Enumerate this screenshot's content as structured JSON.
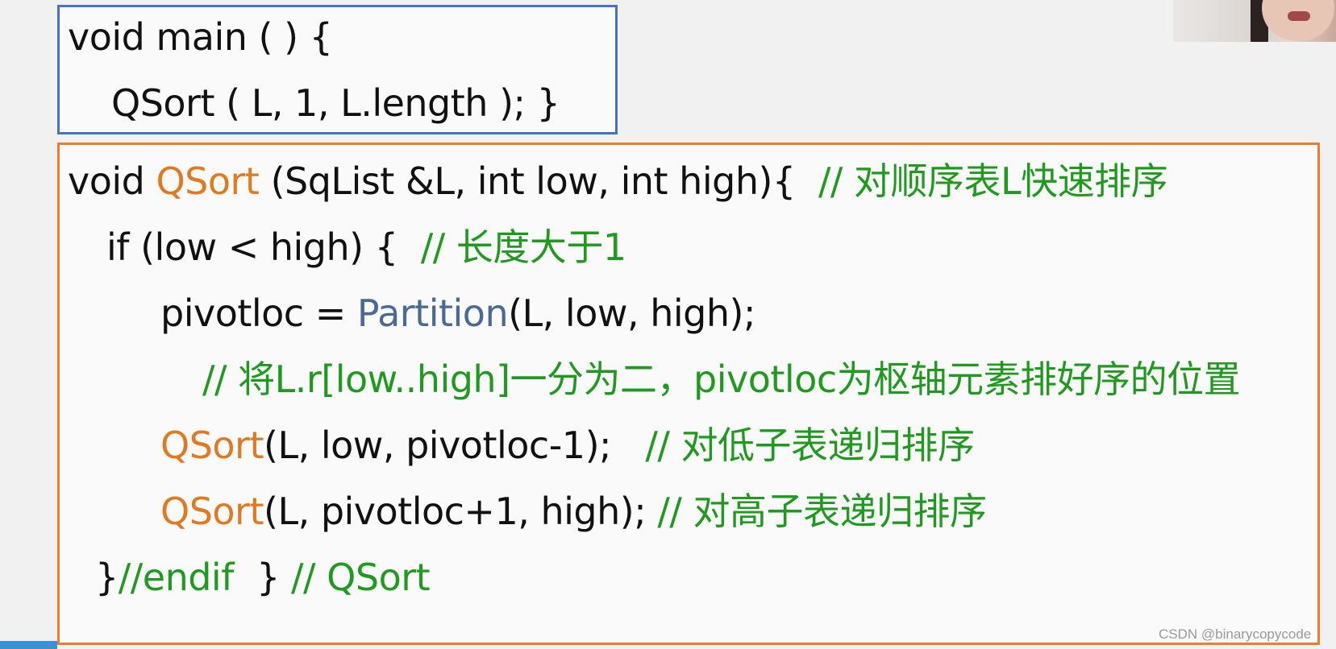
{
  "main_block": {
    "line1": "void main ( ) {",
    "line2": "QSort ( L, 1, L.length ); }"
  },
  "qsort_block": {
    "l1_kw": "void ",
    "l1_fn": "QSort",
    "l1_rest": " (SqList &L, int low, int high){  ",
    "l1_cm": "// 对顺序表L快速排序",
    "l2_code": "if (low < high) {  ",
    "l2_cm": "// 长度大于1",
    "l3_a": "pivotloc = ",
    "l3_call": "Partition",
    "l3_b": "(L, low, high);",
    "l4_cm": "// 将L.r[low..high]一分为二，pivotloc为枢轴元素排好序的位置",
    "l5_fn": "QSort",
    "l5_rest": "(L, low, pivotloc-1);   ",
    "l5_cm": "// 对低子表递归排序",
    "l6_fn": "QSort",
    "l6_rest": "(L, pivotloc+1, high); ",
    "l6_cm": "// 对高子表递归排序",
    "l7_code": "}",
    "l7_cm1": "//endif",
    "l7_mid": "  } ",
    "l7_cm2": "// QSort"
  },
  "watermark": "CSDN @binarycopycode",
  "colors": {
    "main_border": "#4472c4",
    "qsort_border": "#ed7d31",
    "function_name": "#e07a22",
    "call_name": "#4a6a96",
    "comment": "#1f9a1f"
  }
}
